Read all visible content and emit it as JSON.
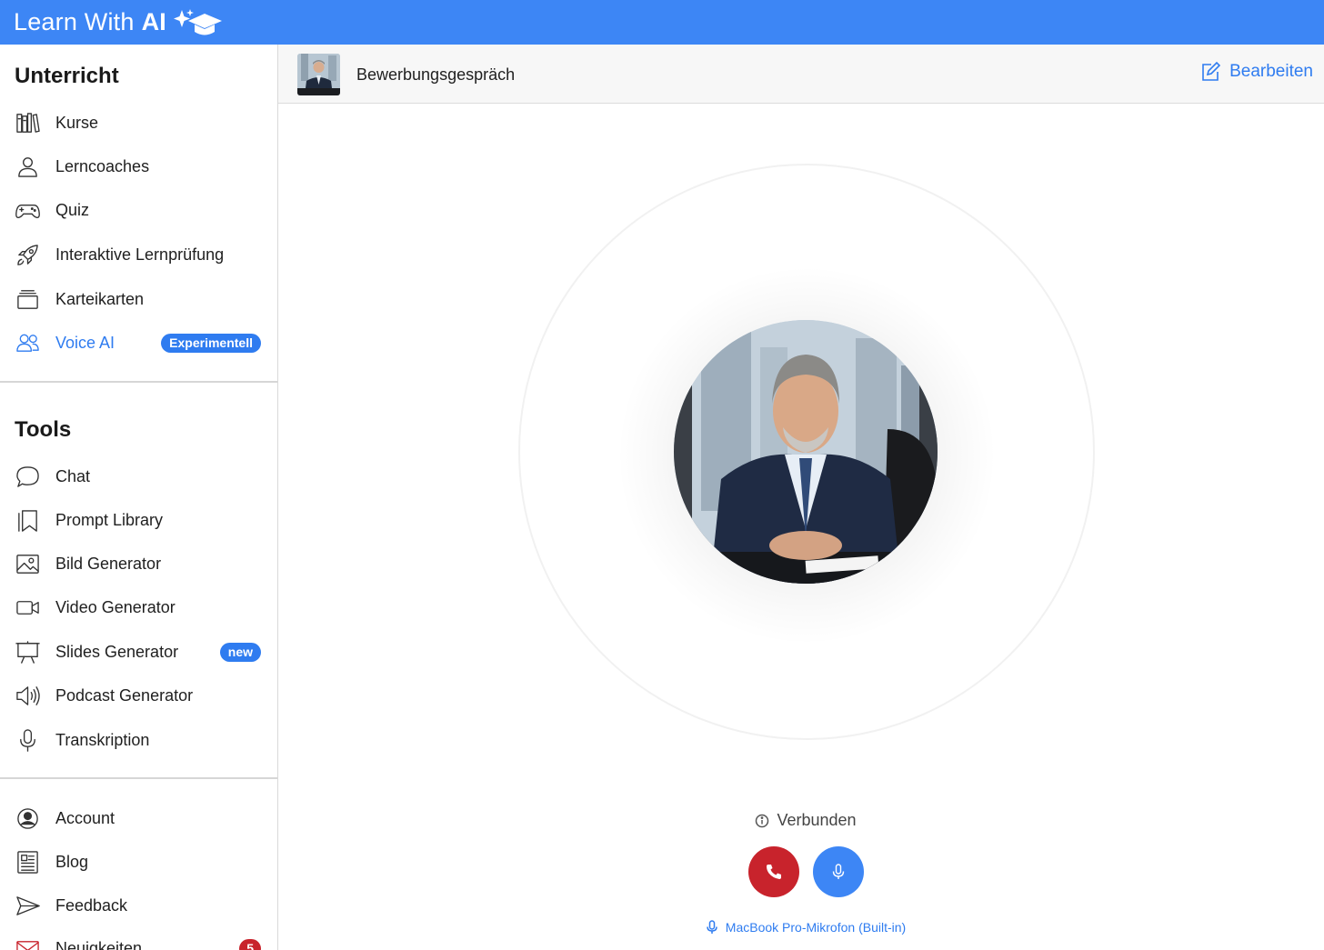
{
  "app": {
    "brand_text": "Learn With",
    "brand_bold": "AI",
    "accent_color": "#3d86f5"
  },
  "sidebar": {
    "section_unterricht": "Unterricht",
    "section_tools": "Tools",
    "unterricht_items": [
      {
        "label": "Kurse",
        "icon": "books-icon"
      },
      {
        "label": "Lerncoaches",
        "icon": "person-icon"
      },
      {
        "label": "Quiz",
        "icon": "gamepad-icon"
      },
      {
        "label": "Interaktive Lernprüfung",
        "icon": "rocket-icon"
      },
      {
        "label": "Karteikarten",
        "icon": "cards-icon"
      },
      {
        "label": "Voice AI",
        "icon": "users-icon",
        "badge": "Experimentell",
        "active": true
      }
    ],
    "tools_items": [
      {
        "label": "Chat",
        "icon": "chat-bubble-icon"
      },
      {
        "label": "Prompt Library",
        "icon": "bookmark-icon"
      },
      {
        "label": "Bild Generator",
        "icon": "image-icon"
      },
      {
        "label": "Video Generator",
        "icon": "video-camera-icon"
      },
      {
        "label": "Slides Generator",
        "icon": "presentation-icon",
        "badge": "new"
      },
      {
        "label": "Podcast Generator",
        "icon": "speaker-icon"
      },
      {
        "label": "Transkription",
        "icon": "microphone-icon"
      }
    ],
    "account_items": [
      {
        "label": "Account",
        "icon": "account-circle-icon"
      },
      {
        "label": "Blog",
        "icon": "newspaper-icon"
      },
      {
        "label": "Feedback",
        "icon": "send-icon"
      },
      {
        "label": "Neuigkeiten",
        "icon": "mail-icon",
        "badge": "5"
      }
    ]
  },
  "header": {
    "title": "Bewerbungsgespräch",
    "edit_label": "Bearbeiten"
  },
  "call": {
    "status": "Verbunden",
    "device": "MacBook Pro-Mikrofon (Built-in)",
    "hangup_color": "#c8232c",
    "mic_color": "#3d86f5"
  }
}
